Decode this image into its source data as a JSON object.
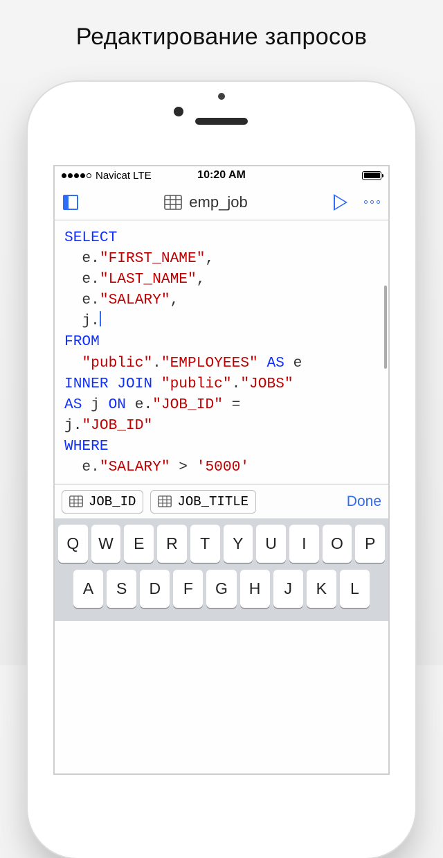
{
  "caption": "Редактирование запросов",
  "status": {
    "carrier": "Navicat LTE",
    "time": "10:20 AM"
  },
  "toolbar": {
    "title": "emp_job"
  },
  "code": {
    "l1": "SELECT",
    "l2_pre": "  e.",
    "l2_str": "\"FIRST_NAME\"",
    "l2_post": ",",
    "l3_pre": "  e.",
    "l3_str": "\"LAST_NAME\"",
    "l3_post": ",",
    "l4_pre": "  e.",
    "l4_str": "\"SALARY\"",
    "l4_post": ",",
    "l5": "  j.",
    "l6": "FROM",
    "l7_pre": "  ",
    "l7_s1": "\"public\"",
    "l7_mid": ".",
    "l7_s2": "\"EMPLOYEES\"",
    "l7_kw": " AS ",
    "l7_post": "e",
    "l8_kw1": "INNER JOIN ",
    "l8_s1": "\"public\"",
    "l8_mid": ".",
    "l8_s2": "\"JOBS\"",
    "l9_kw1": "AS ",
    "l9_a": "j ",
    "l9_kw2": "ON ",
    "l9_b": "e.",
    "l9_s1": "\"JOB_ID\"",
    "l9_post": " =",
    "l10_a": "j.",
    "l10_s1": "\"JOB_ID\"",
    "l11": "WHERE",
    "l12_pre": "  e.",
    "l12_s1": "\"SALARY\"",
    "l12_mid": " > ",
    "l12_s2": "'5000'"
  },
  "suggest": {
    "s1": "JOB_ID",
    "s2": "JOB_TITLE",
    "done": "Done"
  },
  "keyboard": {
    "r1": [
      "Q",
      "W",
      "E",
      "R",
      "T",
      "Y",
      "U",
      "I",
      "O",
      "P"
    ],
    "r2": [
      "A",
      "S",
      "D",
      "F",
      "G",
      "H",
      "J",
      "K",
      "L"
    ]
  }
}
